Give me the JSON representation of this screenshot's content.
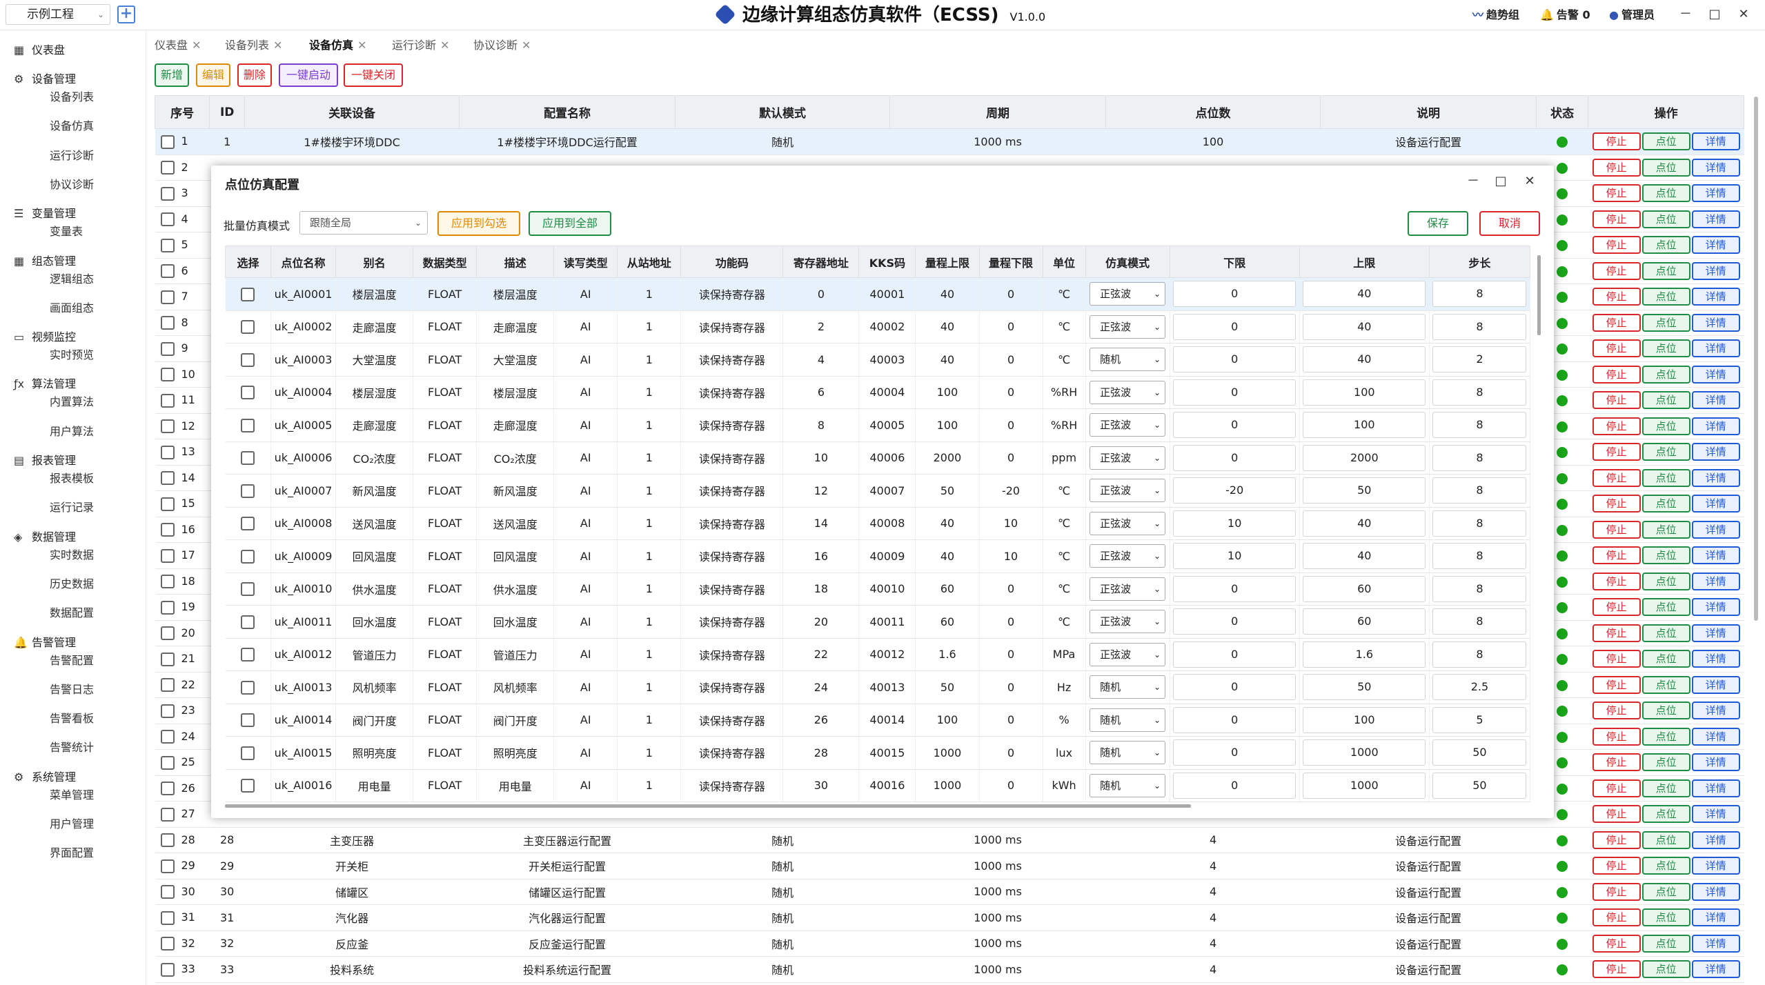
{
  "header": {
    "project": "示例工程",
    "title": "边缘计算组态仿真软件（ECSS)",
    "version": "V1.0.0",
    "trend": "趋势组",
    "alarm": "告警 0",
    "admin": "管理员",
    "min": "－",
    "max": "□",
    "close": "✕"
  },
  "sidebar": [
    {
      "group": "仪表盘",
      "icon": "▦",
      "items": []
    },
    {
      "group": "设备管理",
      "icon": "⚙",
      "items": [
        "设备列表",
        "设备仿真",
        "运行诊断",
        "协议诊断"
      ]
    },
    {
      "group": "变量管理",
      "icon": "☰",
      "items": [
        "变量表"
      ]
    },
    {
      "group": "组态管理",
      "icon": "▦",
      "items": [
        "逻辑组态",
        "画面组态"
      ]
    },
    {
      "group": "视频监控",
      "icon": "▭",
      "items": [
        "实时预览"
      ]
    },
    {
      "group": "算法管理",
      "icon": "ƒx",
      "items": [
        "内置算法",
        "用户算法"
      ]
    },
    {
      "group": "报表管理",
      "icon": "▤",
      "items": [
        "报表模板",
        "运行记录"
      ]
    },
    {
      "group": "数据管理",
      "icon": "◈",
      "items": [
        "实时数据",
        "历史数据",
        "数据配置"
      ]
    },
    {
      "group": "告警管理",
      "icon": "🔔",
      "items": [
        "告警配置",
        "告警日志",
        "告警看板",
        "告警统计"
      ]
    },
    {
      "group": "系统管理",
      "icon": "⚙",
      "items": [
        "菜单管理",
        "用户管理",
        "界面配置"
      ]
    }
  ],
  "tabs": [
    {
      "label": "仪表盘",
      "active": false
    },
    {
      "label": "设备列表",
      "active": false
    },
    {
      "label": "设备仿真",
      "active": true
    },
    {
      "label": "运行诊断",
      "active": false
    },
    {
      "label": "协议诊断",
      "active": false
    }
  ],
  "toolbar": {
    "add": "新增",
    "edit": "编辑",
    "delete": "删除",
    "start_all": "一键启动",
    "stop_all": "一键关闭"
  },
  "main_table": {
    "headers": [
      "序号",
      "ID",
      "关联设备",
      "配置名称",
      "默认模式",
      "周期",
      "点位数",
      "说明",
      "状态",
      "操作"
    ],
    "action_labels": {
      "stop": "停止",
      "points": "点位",
      "detail": "详情"
    },
    "rows": [
      {
        "seq": "1",
        "id": "1",
        "device": "1#楼楼宇环境DDC",
        "config": "1#楼楼宇环境DDC运行配置",
        "mode": "随机",
        "period": "1000 ms",
        "points": "100",
        "desc": "设备运行配置",
        "selected": true
      },
      {
        "seq": "2",
        "id": "",
        "device": "",
        "config": "",
        "mode": "",
        "period": "",
        "points": "",
        "desc": ""
      },
      {
        "seq": "3",
        "id": "",
        "device": "",
        "config": "",
        "mode": "",
        "period": "",
        "points": "",
        "desc": ""
      },
      {
        "seq": "4",
        "id": "",
        "device": "",
        "config": "",
        "mode": "",
        "period": "",
        "points": "",
        "desc": ""
      },
      {
        "seq": "5",
        "id": "",
        "device": "",
        "config": "",
        "mode": "",
        "period": "",
        "points": "",
        "desc": ""
      },
      {
        "seq": "6",
        "id": "",
        "device": "",
        "config": "",
        "mode": "",
        "period": "",
        "points": "",
        "desc": ""
      },
      {
        "seq": "7",
        "id": "",
        "device": "",
        "config": "",
        "mode": "",
        "period": "",
        "points": "",
        "desc": ""
      },
      {
        "seq": "8",
        "id": "",
        "device": "",
        "config": "",
        "mode": "",
        "period": "",
        "points": "",
        "desc": ""
      },
      {
        "seq": "9",
        "id": "",
        "device": "",
        "config": "",
        "mode": "",
        "period": "",
        "points": "",
        "desc": ""
      },
      {
        "seq": "10",
        "id": "",
        "device": "",
        "config": "",
        "mode": "",
        "period": "",
        "points": "",
        "desc": ""
      },
      {
        "seq": "11",
        "id": "",
        "device": "",
        "config": "",
        "mode": "",
        "period": "",
        "points": "",
        "desc": ""
      },
      {
        "seq": "12",
        "id": "",
        "device": "",
        "config": "",
        "mode": "",
        "period": "",
        "points": "",
        "desc": ""
      },
      {
        "seq": "13",
        "id": "",
        "device": "",
        "config": "",
        "mode": "",
        "period": "",
        "points": "",
        "desc": ""
      },
      {
        "seq": "14",
        "id": "",
        "device": "",
        "config": "",
        "mode": "",
        "period": "",
        "points": "",
        "desc": ""
      },
      {
        "seq": "15",
        "id": "",
        "device": "",
        "config": "",
        "mode": "",
        "period": "",
        "points": "",
        "desc": ""
      },
      {
        "seq": "16",
        "id": "",
        "device": "",
        "config": "",
        "mode": "",
        "period": "",
        "points": "",
        "desc": ""
      },
      {
        "seq": "17",
        "id": "",
        "device": "",
        "config": "",
        "mode": "",
        "period": "",
        "points": "",
        "desc": ""
      },
      {
        "seq": "18",
        "id": "",
        "device": "",
        "config": "",
        "mode": "",
        "period": "",
        "points": "",
        "desc": ""
      },
      {
        "seq": "19",
        "id": "",
        "device": "",
        "config": "",
        "mode": "",
        "period": "",
        "points": "",
        "desc": ""
      },
      {
        "seq": "20",
        "id": "",
        "device": "",
        "config": "",
        "mode": "",
        "period": "",
        "points": "",
        "desc": ""
      },
      {
        "seq": "21",
        "id": "",
        "device": "",
        "config": "",
        "mode": "",
        "period": "",
        "points": "",
        "desc": ""
      },
      {
        "seq": "22",
        "id": "",
        "device": "",
        "config": "",
        "mode": "",
        "period": "",
        "points": "",
        "desc": ""
      },
      {
        "seq": "23",
        "id": "",
        "device": "",
        "config": "",
        "mode": "",
        "period": "",
        "points": "",
        "desc": ""
      },
      {
        "seq": "24",
        "id": "",
        "device": "",
        "config": "",
        "mode": "",
        "period": "",
        "points": "",
        "desc": ""
      },
      {
        "seq": "25",
        "id": "",
        "device": "",
        "config": "",
        "mode": "",
        "period": "",
        "points": "",
        "desc": ""
      },
      {
        "seq": "26",
        "id": "",
        "device": "",
        "config": "",
        "mode": "",
        "period": "",
        "points": "",
        "desc": ""
      },
      {
        "seq": "27",
        "id": "",
        "device": "",
        "config": "",
        "mode": "",
        "period": "",
        "points": "",
        "desc": ""
      },
      {
        "seq": "28",
        "id": "28",
        "device": "主变压器",
        "config": "主变压器运行配置",
        "mode": "随机",
        "period": "1000 ms",
        "points": "4",
        "desc": "设备运行配置"
      },
      {
        "seq": "29",
        "id": "29",
        "device": "开关柜",
        "config": "开关柜运行配置",
        "mode": "随机",
        "period": "1000 ms",
        "points": "4",
        "desc": "设备运行配置"
      },
      {
        "seq": "30",
        "id": "30",
        "device": "储罐区",
        "config": "储罐区运行配置",
        "mode": "随机",
        "period": "1000 ms",
        "points": "4",
        "desc": "设备运行配置"
      },
      {
        "seq": "31",
        "id": "31",
        "device": "汽化器",
        "config": "汽化器运行配置",
        "mode": "随机",
        "period": "1000 ms",
        "points": "4",
        "desc": "设备运行配置"
      },
      {
        "seq": "32",
        "id": "32",
        "device": "反应釜",
        "config": "反应釜运行配置",
        "mode": "随机",
        "period": "1000 ms",
        "points": "4",
        "desc": "设备运行配置"
      },
      {
        "seq": "33",
        "id": "33",
        "device": "投料系统",
        "config": "投料系统运行配置",
        "mode": "随机",
        "period": "1000 ms",
        "points": "4",
        "desc": "设备运行配置"
      }
    ]
  },
  "dialog": {
    "title": "点位仿真配置",
    "batch_label": "批量仿真模式",
    "batch_value": "跟随全局",
    "apply_checked": "应用到勾选",
    "apply_all": "应用到全部",
    "save": "保存",
    "cancel": "取消",
    "headers": [
      "选择",
      "点位名称",
      "别名",
      "数据类型",
      "描述",
      "读写类型",
      "从站地址",
      "功能码",
      "寄存器地址",
      "KKS码",
      "量程上限",
      "量程下限",
      "单位",
      "仿真模式",
      "下限",
      "上限",
      "步长"
    ],
    "rows": [
      {
        "name": "uk_AI0001",
        "alias": "楼层温度",
        "type": "FLOAT",
        "desc": "楼层温度",
        "rw": "AI",
        "slave": "1",
        "func": "读保持寄存器",
        "reg": "0",
        "kks": "40001",
        "rmax": "40",
        "rmin": "0",
        "unit": "℃",
        "mode": "正弦波",
        "low": "0",
        "high": "40",
        "step": "8",
        "selected": true
      },
      {
        "name": "uk_AI0002",
        "alias": "走廊温度",
        "type": "FLOAT",
        "desc": "走廊温度",
        "rw": "AI",
        "slave": "1",
        "func": "读保持寄存器",
        "reg": "2",
        "kks": "40002",
        "rmax": "40",
        "rmin": "0",
        "unit": "℃",
        "mode": "正弦波",
        "low": "0",
        "high": "40",
        "step": "8"
      },
      {
        "name": "uk_AI0003",
        "alias": "大堂温度",
        "type": "FLOAT",
        "desc": "大堂温度",
        "rw": "AI",
        "slave": "1",
        "func": "读保持寄存器",
        "reg": "4",
        "kks": "40003",
        "rmax": "40",
        "rmin": "0",
        "unit": "℃",
        "mode": "随机",
        "low": "0",
        "high": "40",
        "step": "2"
      },
      {
        "name": "uk_AI0004",
        "alias": "楼层湿度",
        "type": "FLOAT",
        "desc": "楼层湿度",
        "rw": "AI",
        "slave": "1",
        "func": "读保持寄存器",
        "reg": "6",
        "kks": "40004",
        "rmax": "100",
        "rmin": "0",
        "unit": "%RH",
        "mode": "正弦波",
        "low": "0",
        "high": "100",
        "step": "8"
      },
      {
        "name": "uk_AI0005",
        "alias": "走廊湿度",
        "type": "FLOAT",
        "desc": "走廊湿度",
        "rw": "AI",
        "slave": "1",
        "func": "读保持寄存器",
        "reg": "8",
        "kks": "40005",
        "rmax": "100",
        "rmin": "0",
        "unit": "%RH",
        "mode": "正弦波",
        "low": "0",
        "high": "100",
        "step": "8"
      },
      {
        "name": "uk_AI0006",
        "alias": "CO₂浓度",
        "type": "FLOAT",
        "desc": "CO₂浓度",
        "rw": "AI",
        "slave": "1",
        "func": "读保持寄存器",
        "reg": "10",
        "kks": "40006",
        "rmax": "2000",
        "rmin": "0",
        "unit": "ppm",
        "mode": "正弦波",
        "low": "0",
        "high": "2000",
        "step": "8"
      },
      {
        "name": "uk_AI0007",
        "alias": "新风温度",
        "type": "FLOAT",
        "desc": "新风温度",
        "rw": "AI",
        "slave": "1",
        "func": "读保持寄存器",
        "reg": "12",
        "kks": "40007",
        "rmax": "50",
        "rmin": "-20",
        "unit": "℃",
        "mode": "正弦波",
        "low": "-20",
        "high": "50",
        "step": "8"
      },
      {
        "name": "uk_AI0008",
        "alias": "送风温度",
        "type": "FLOAT",
        "desc": "送风温度",
        "rw": "AI",
        "slave": "1",
        "func": "读保持寄存器",
        "reg": "14",
        "kks": "40008",
        "rmax": "40",
        "rmin": "10",
        "unit": "℃",
        "mode": "正弦波",
        "low": "10",
        "high": "40",
        "step": "8"
      },
      {
        "name": "uk_AI0009",
        "alias": "回风温度",
        "type": "FLOAT",
        "desc": "回风温度",
        "rw": "AI",
        "slave": "1",
        "func": "读保持寄存器",
        "reg": "16",
        "kks": "40009",
        "rmax": "40",
        "rmin": "10",
        "unit": "℃",
        "mode": "正弦波",
        "low": "10",
        "high": "40",
        "step": "8"
      },
      {
        "name": "uk_AI0010",
        "alias": "供水温度",
        "type": "FLOAT",
        "desc": "供水温度",
        "rw": "AI",
        "slave": "1",
        "func": "读保持寄存器",
        "reg": "18",
        "kks": "40010",
        "rmax": "60",
        "rmin": "0",
        "unit": "℃",
        "mode": "正弦波",
        "low": "0",
        "high": "60",
        "step": "8"
      },
      {
        "name": "uk_AI0011",
        "alias": "回水温度",
        "type": "FLOAT",
        "desc": "回水温度",
        "rw": "AI",
        "slave": "1",
        "func": "读保持寄存器",
        "reg": "20",
        "kks": "40011",
        "rmax": "60",
        "rmin": "0",
        "unit": "℃",
        "mode": "正弦波",
        "low": "0",
        "high": "60",
        "step": "8"
      },
      {
        "name": "uk_AI0012",
        "alias": "管道压力",
        "type": "FLOAT",
        "desc": "管道压力",
        "rw": "AI",
        "slave": "1",
        "func": "读保持寄存器",
        "reg": "22",
        "kks": "40012",
        "rmax": "1.6",
        "rmin": "0",
        "unit": "MPa",
        "mode": "正弦波",
        "low": "0",
        "high": "1.6",
        "step": "8"
      },
      {
        "name": "uk_AI0013",
        "alias": "风机频率",
        "type": "FLOAT",
        "desc": "风机频率",
        "rw": "AI",
        "slave": "1",
        "func": "读保持寄存器",
        "reg": "24",
        "kks": "40013",
        "rmax": "50",
        "rmin": "0",
        "unit": "Hz",
        "mode": "随机",
        "low": "0",
        "high": "50",
        "step": "2.5"
      },
      {
        "name": "uk_AI0014",
        "alias": "阀门开度",
        "type": "FLOAT",
        "desc": "阀门开度",
        "rw": "AI",
        "slave": "1",
        "func": "读保持寄存器",
        "reg": "26",
        "kks": "40014",
        "rmax": "100",
        "rmin": "0",
        "unit": "%",
        "mode": "随机",
        "low": "0",
        "high": "100",
        "step": "5"
      },
      {
        "name": "uk_AI0015",
        "alias": "照明亮度",
        "type": "FLOAT",
        "desc": "照明亮度",
        "rw": "AI",
        "slave": "1",
        "func": "读保持寄存器",
        "reg": "28",
        "kks": "40015",
        "rmax": "1000",
        "rmin": "0",
        "unit": "lux",
        "mode": "随机",
        "low": "0",
        "high": "1000",
        "step": "50"
      },
      {
        "name": "uk_AI0016",
        "alias": "用电量",
        "type": "FLOAT",
        "desc": "用电量",
        "rw": "AI",
        "slave": "1",
        "func": "读保持寄存器",
        "reg": "30",
        "kks": "40016",
        "rmax": "1000",
        "rmin": "0",
        "unit": "kWh",
        "mode": "随机",
        "low": "0",
        "high": "1000",
        "step": "50"
      }
    ]
  }
}
